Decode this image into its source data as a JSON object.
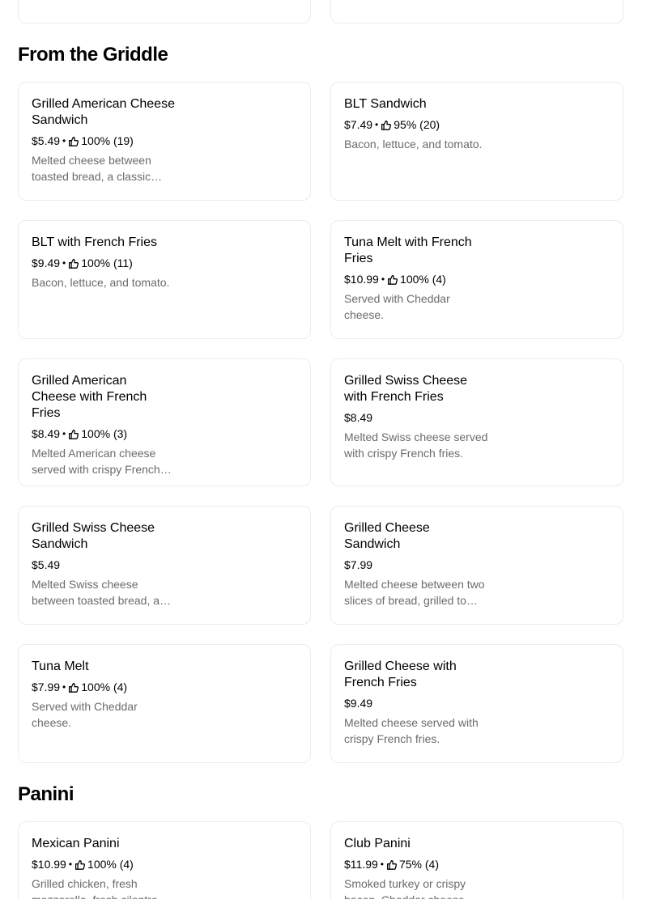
{
  "sections": {
    "griddle": {
      "title": "From the Griddle",
      "items": [
        {
          "name": "Grilled American Cheese Sandwich",
          "price": "$5.49",
          "rating": "100% (19)",
          "description": "Melted cheese between toasted bread, a classic comfort food."
        },
        {
          "name": "BLT Sandwich",
          "price": "$7.49",
          "rating": "95% (20)",
          "description": "Bacon, lettuce, and tomato."
        },
        {
          "name": "BLT with French Fries",
          "price": "$9.49",
          "rating": "100% (11)",
          "description": "Bacon, lettuce, and tomato."
        },
        {
          "name": "Tuna Melt with French Fries",
          "price": "$10.99",
          "rating": "100% (4)",
          "description": "Served with Cheddar cheese."
        },
        {
          "name": "Grilled American Cheese with French Fries",
          "price": "$8.49",
          "rating": "100% (3)",
          "description": "Melted American cheese served with crispy French fries."
        },
        {
          "name": "Grilled Swiss Cheese with French Fries",
          "price": "$8.49",
          "rating": "",
          "description": "Melted Swiss cheese served with crispy French fries."
        },
        {
          "name": "Grilled Swiss Cheese Sandwich",
          "price": "$5.49",
          "rating": "",
          "description": "Melted Swiss cheese between toasted bread, a classic."
        },
        {
          "name": "Grilled Cheese Sandwich",
          "price": "$7.99",
          "rating": "",
          "description": "Melted cheese between two slices of bread, grilled to perfection."
        },
        {
          "name": "Tuna Melt",
          "price": "$7.99",
          "rating": "100% (4)",
          "description": "Served with Cheddar cheese."
        },
        {
          "name": "Grilled Cheese with French Fries",
          "price": "$9.49",
          "rating": "",
          "description": "Melted cheese served with crispy French fries."
        }
      ]
    },
    "panini": {
      "title": "Panini",
      "items": [
        {
          "name": "Mexican Panini",
          "price": "$10.99",
          "rating": "100% (4)",
          "description": "Grilled chicken, fresh mozzarella, fresh cilantro."
        },
        {
          "name": "Club Panini",
          "price": "$11.99",
          "rating": "75% (4)",
          "description": "Smoked turkey or crispy bacon, Cheddar cheese."
        }
      ]
    }
  },
  "icons": {
    "rating": "thumbs-up-icon"
  },
  "separator": "•"
}
